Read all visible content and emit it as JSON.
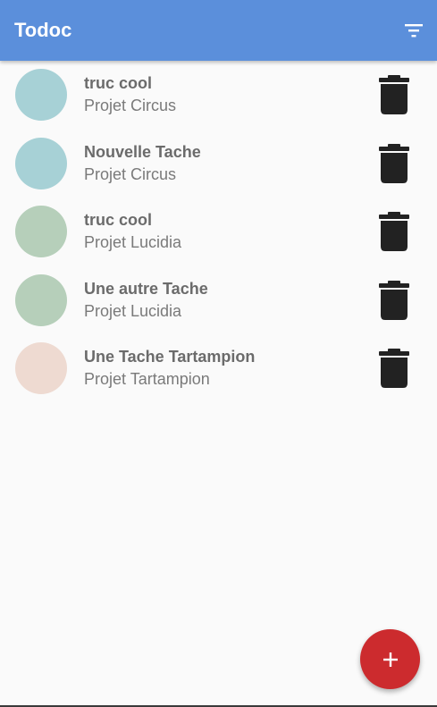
{
  "app": {
    "title": "Todoc"
  },
  "toolbar": {
    "filter_icon": "filter-list-icon"
  },
  "tasks": [
    {
      "name": "truc cool",
      "project": "Projet Circus",
      "color": "#a7d1d6"
    },
    {
      "name": "Nouvelle Tache",
      "project": "Projet Circus",
      "color": "#a7d1d6"
    },
    {
      "name": "truc cool",
      "project": "Projet Lucidia",
      "color": "#b6cfba"
    },
    {
      "name": "Une autre Tache",
      "project": "Projet Lucidia",
      "color": "#b6cfba"
    },
    {
      "name": "Une Tache Tartampion",
      "project": "Projet Tartampion",
      "color": "#eedad1"
    }
  ],
  "fab": {
    "icon": "plus-icon",
    "color": "#cc2b2e"
  },
  "colors": {
    "appbar": "#5b8fdb",
    "delete_icon": "#222222"
  }
}
